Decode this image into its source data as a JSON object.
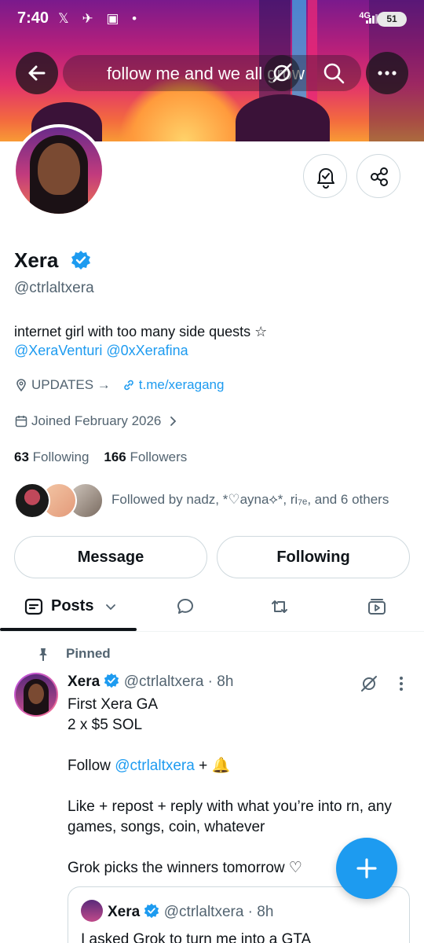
{
  "status_bar": {
    "time": "7:40",
    "network": "4G",
    "battery": "51"
  },
  "nav": {
    "title": "follow me and we all grow"
  },
  "profile": {
    "name": "Xera",
    "handle": "@ctrlaltxera",
    "bio_text": "internet girl with too many side quests ☆",
    "bio_mention_1": "@XeraVenturi",
    "bio_mention_2": "@0xXerafina",
    "updates_label": "UPDATES →",
    "website": "t.me/xeragang",
    "joined": "Joined February 2026",
    "following_count": "63",
    "following_label": "Following",
    "followers_count": "166",
    "followers_label": "Followers",
    "followed_by": "Followed by nadz, *♡ayna⟡*, ri₇ₑ, and 6 others"
  },
  "actions": {
    "message": "Message",
    "following": "Following"
  },
  "tabs": {
    "posts": "Posts"
  },
  "post": {
    "pinned_label": "Pinned",
    "author": "Xera",
    "handle_time": "@ctrlaltxera · 8h",
    "line1": "First Xera GA",
    "line2": "2 x $5 SOL",
    "follow_prefix": "Follow ",
    "follow_mention": "@ctrlaltxera",
    "follow_suffix": " + 🔔",
    "line4": "Like + repost + reply with what you’re into rn, any games, songs, coin, whatever",
    "line5": "Grok picks the winners tomorrow ♡"
  },
  "quote": {
    "author": "Xera",
    "handle_time": "@ctrlaltxera · 8h",
    "text": "I asked Grok to turn me into a GTA"
  },
  "colors": {
    "accent": "#1d9bf0",
    "text": "#0f1419",
    "muted": "#536471",
    "border": "#cfd9de"
  }
}
